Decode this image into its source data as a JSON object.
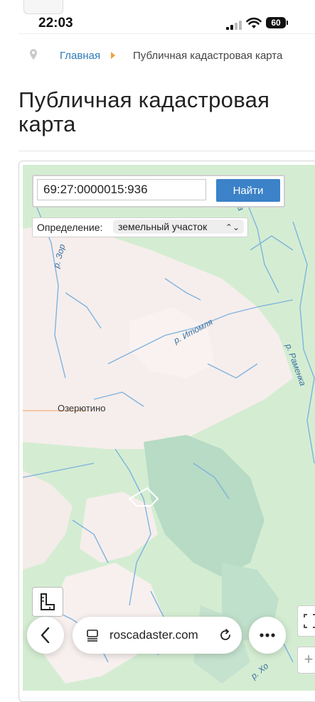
{
  "status_bar": {
    "time": "22:03",
    "battery": "60"
  },
  "breadcrumb": {
    "home": "Главная",
    "current": "Публичная кадастровая карта"
  },
  "page": {
    "title": "Публичная кадастровая карта"
  },
  "search": {
    "value": "69:27:0000015:936",
    "button_label": "Найти"
  },
  "definition": {
    "label": "Определение:",
    "selected": "земельный участок"
  },
  "map": {
    "place_labels": [
      "Озерютино"
    ],
    "river_labels": [
      "р. Итомля",
      "р. Раменка",
      "р. Зор",
      "р. Хо",
      "ка"
    ]
  },
  "browser": {
    "url": "roscadaster.com"
  },
  "colors": {
    "accent": "#3b82c8",
    "link": "#2e7bb8",
    "map_green": "#d6eed4",
    "map_light": "#f7efee",
    "river": "#7fb3df"
  },
  "icons": [
    "location-pin-icon",
    "chevron-right-icon",
    "ruler-icon",
    "fullscreen-icon",
    "back-arrow-icon",
    "tabs-icon",
    "reload-icon",
    "more-icon"
  ]
}
